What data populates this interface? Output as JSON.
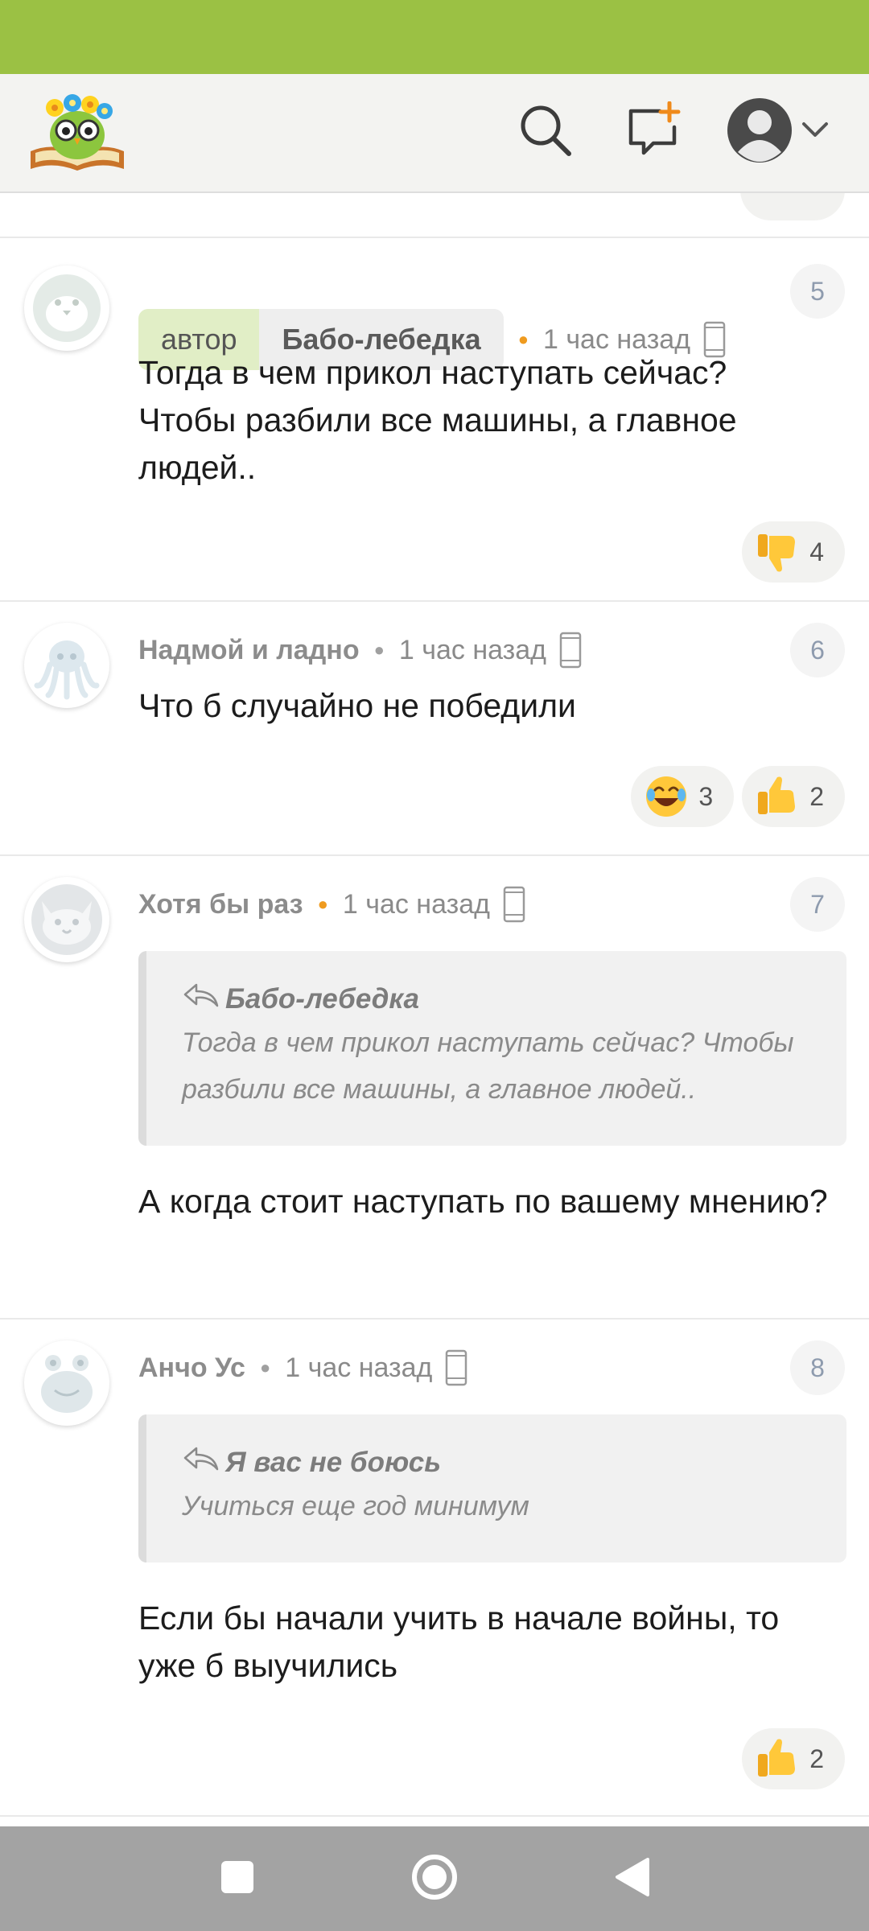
{
  "colors": {
    "status_bar": "#9bc144",
    "header_bg": "#f3f3f1",
    "author_tag_bg": "#e1eec6",
    "orange_dot": "#ef9b1f",
    "number_badge": "#8e9bae",
    "nav_bar": "#a3a3a3"
  },
  "header": {
    "logo": "owl-with-book-logo",
    "icons": [
      "search-icon",
      "new-post-icon",
      "avatar-icon",
      "chevron-down-icon"
    ]
  },
  "comments": [
    {
      "number": "5",
      "tag_label": "автор",
      "author": "Бабо-лебедка",
      "time": "1 час назад",
      "device": "phone-icon",
      "avatar": "penguin-avatar",
      "text": "Тогда в чем прикол наступать сейчас? Чтобы разбили все машины, а главное людей..",
      "reactions": [
        {
          "icon": "thumbs-down-icon",
          "count": "4"
        }
      ]
    },
    {
      "number": "6",
      "author": "Надмой и ладно",
      "time": "1 час назад",
      "device": "phone-icon",
      "avatar": "octopus-avatar",
      "text": "Что б случайно не победили",
      "reactions": [
        {
          "icon": "laughing-emoji-icon",
          "count": "3"
        },
        {
          "icon": "thumbs-up-icon",
          "count": "2"
        }
      ]
    },
    {
      "number": "7",
      "author": "Хотя бы раз",
      "time": "1 час назад",
      "device": "phone-icon",
      "avatar": "cat-avatar",
      "quote": {
        "author": "Бабо-лебедка",
        "text": "Тогда в чем прикол наступать сейчас? Чтобы разбили все машины, а главное людей.."
      },
      "text": "А когда стоит наступать по вашему мнению?"
    },
    {
      "number": "8",
      "author": "Анчо Ус",
      "time": "1 час назад",
      "device": "phone-icon",
      "avatar": "frog-avatar",
      "quote": {
        "author": "Я вас не боюсь",
        "text": "Учиться еще год минимум"
      },
      "text": "Если бы начали учить в начале войны, то уже б выучились",
      "reactions": [
        {
          "icon": "thumbs-up-icon",
          "count": "2"
        }
      ]
    }
  ],
  "system_nav": [
    "recents-square-icon",
    "home-circle-icon",
    "back-triangle-icon"
  ]
}
